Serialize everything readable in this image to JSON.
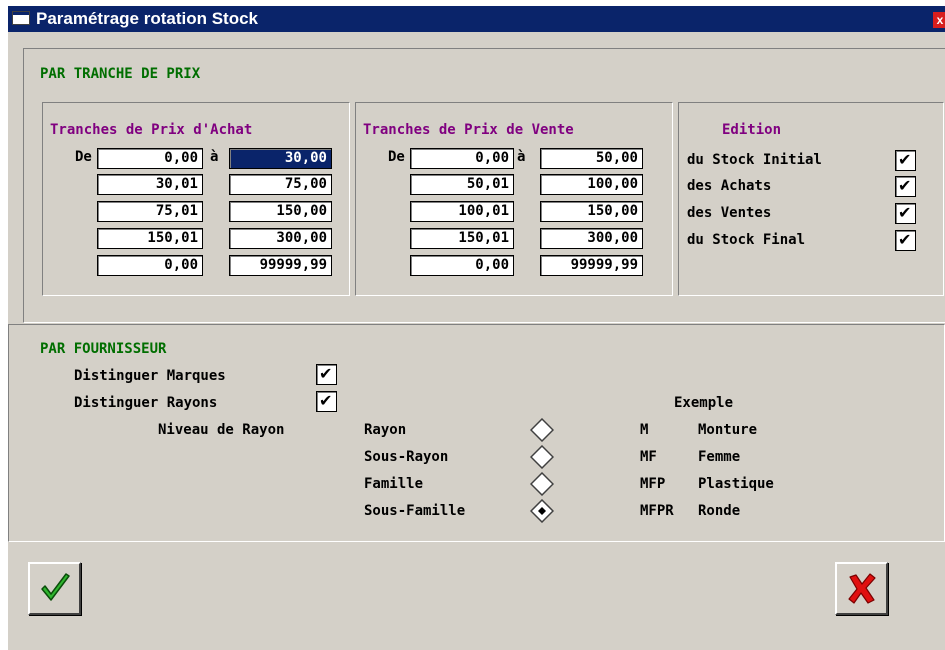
{
  "window": {
    "title": "Paramétrage rotation Stock",
    "close_glyph": "x"
  },
  "price_section": {
    "heading": "PAR TRANCHE DE PRIX",
    "purchase": {
      "heading": "Tranches de Prix d'Achat",
      "from_label": "De",
      "to_label": "à",
      "rows": [
        {
          "from": "0,00",
          "to": "30,00"
        },
        {
          "from": "30,01",
          "to": "75,00"
        },
        {
          "from": "75,01",
          "to": "150,00"
        },
        {
          "from": "150,01",
          "to": "300,00"
        },
        {
          "from": "0,00",
          "to": "99999,99"
        }
      ]
    },
    "sale": {
      "heading": "Tranches de Prix de Vente",
      "from_label": "De",
      "to_label": "à",
      "rows": [
        {
          "from": "0,00",
          "to": "50,00"
        },
        {
          "from": "50,01",
          "to": "100,00"
        },
        {
          "from": "100,01",
          "to": "150,00"
        },
        {
          "from": "150,01",
          "to": "300,00"
        },
        {
          "from": "0,00",
          "to": "99999,99"
        }
      ]
    },
    "edition": {
      "heading": "Edition",
      "items": [
        {
          "label": "du Stock Initial",
          "checked": true
        },
        {
          "label": "des Achats",
          "checked": true
        },
        {
          "label": "des Ventes",
          "checked": true
        },
        {
          "label": "du Stock Final",
          "checked": true
        }
      ]
    }
  },
  "supplier_section": {
    "heading": "PAR FOURNISSEUR",
    "distinguish_brands": {
      "label": "Distinguer Marques",
      "checked": true
    },
    "distinguish_departments": {
      "label": "Distinguer Rayons",
      "checked": true
    },
    "level_label": "Niveau de Rayon",
    "example_heading": "Exemple",
    "levels": [
      {
        "label": "Rayon",
        "selected": false,
        "code": "M",
        "example": "Monture"
      },
      {
        "label": "Sous-Rayon",
        "selected": false,
        "code": "MF",
        "example": "Femme"
      },
      {
        "label": "Famille",
        "selected": false,
        "code": "MFP",
        "example": "Plastique"
      },
      {
        "label": "Sous-Famille",
        "selected": true,
        "code": "MFPR",
        "example": "Ronde"
      }
    ]
  },
  "buttons": {
    "ok_icon": "green-checkmark-icon",
    "cancel_icon": "red-x-icon"
  },
  "colors": {
    "title_bar": "#0a246a",
    "section_heading": "#006e00",
    "sub_heading": "#800080",
    "window_bg": "#d4d0c8"
  }
}
